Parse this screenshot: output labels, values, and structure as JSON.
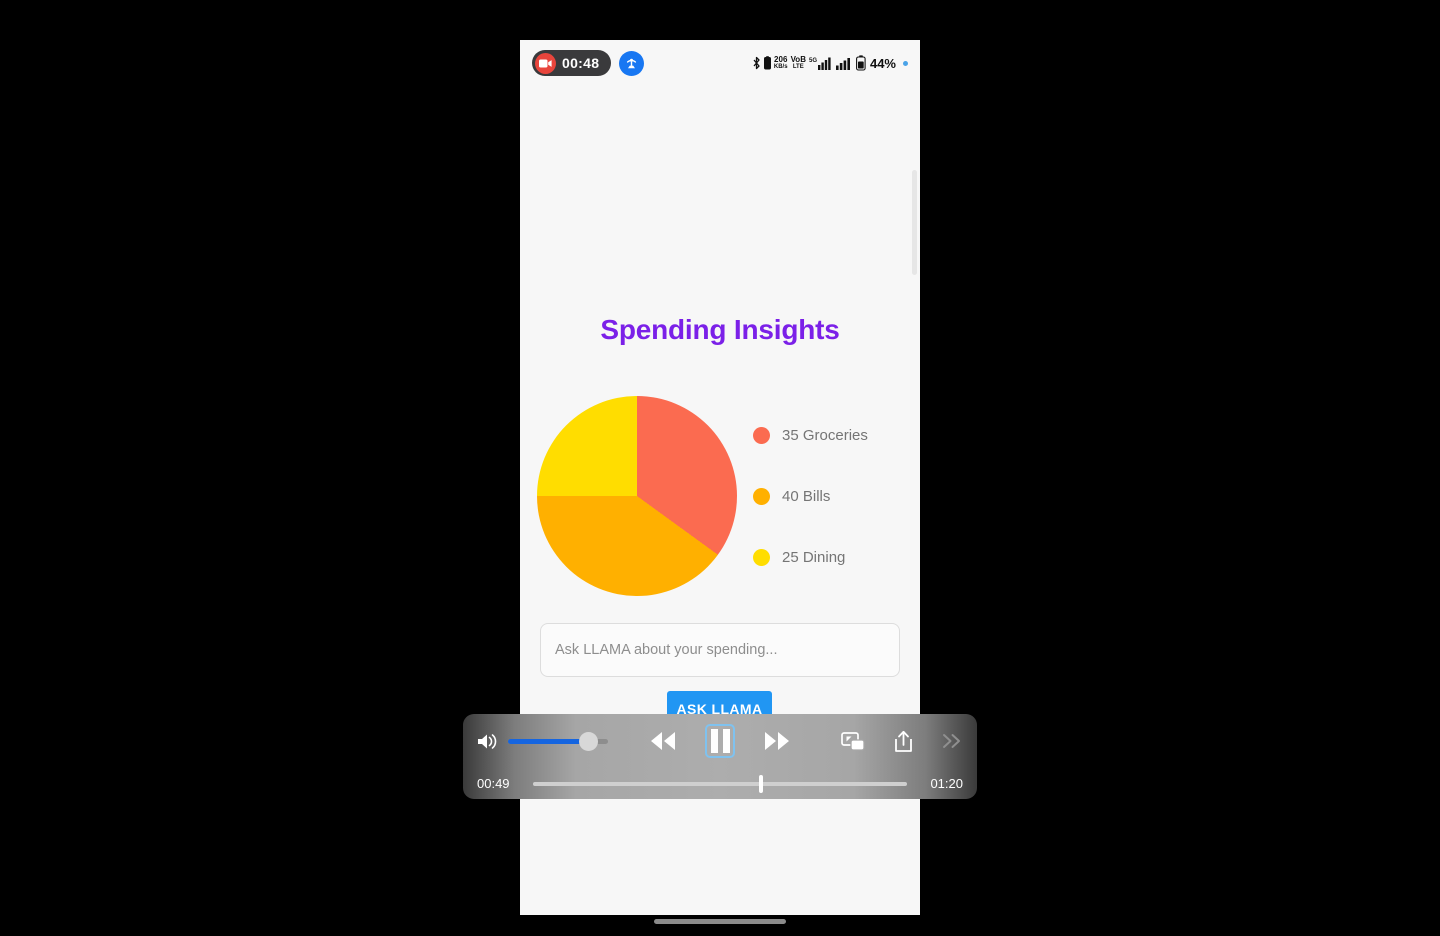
{
  "status_bar": {
    "recording_time": "00:48",
    "recording_icon": "camcorder-icon",
    "cast_icon": "screen-cast-icon",
    "bluetooth_icon": "bluetooth-icon",
    "data_speed_top": "206",
    "data_speed_bottom": "KB/s",
    "volte_top": "VoB",
    "volte_bottom": "LTE",
    "network_type": "5G",
    "battery_percent": "44%"
  },
  "page": {
    "title": "Spending Insights"
  },
  "chart_data": {
    "type": "pie",
    "title": "Spending Insights",
    "categories": [
      "Groceries",
      "Bills",
      "Dining"
    ],
    "values": [
      35,
      40,
      25
    ],
    "colors": [
      "#fb6b50",
      "#ffb000",
      "#ffdd00"
    ],
    "legend_position": "right",
    "legend": [
      {
        "label": "35 Groceries",
        "value": 35,
        "name": "Groceries",
        "color": "#fb6b50"
      },
      {
        "label": "40 Bills",
        "value": 40,
        "name": "Bills",
        "color": "#ffb000"
      },
      {
        "label": "25 Dining",
        "value": 25,
        "name": "Dining",
        "color": "#ffdd00"
      }
    ],
    "start_angle_deg": 0,
    "direction": "clockwise",
    "total": 100
  },
  "form": {
    "input_placeholder": "Ask LLAMA about your spending...",
    "input_value": "",
    "button_label": "ASK LLAMA",
    "button_color": "#2196f3"
  },
  "media_controls": {
    "volume_icon": "speaker-wave-icon",
    "volume_percent": 80,
    "rewind_icon": "rewind-icon",
    "pause_icon": "pause-icon",
    "forward_icon": "fast-forward-icon",
    "pip_icon": "picture-in-picture-icon",
    "share_icon": "share-icon",
    "expand_icon": "chevron-double-right-icon",
    "current_time": "00:49",
    "total_time": "01:20",
    "progress_percent": 61
  },
  "theme": {
    "title_purple": "#7b20e8",
    "accent_blue": "#2196f3",
    "page_background": "#f7f7f7",
    "outer_background": "#000000"
  }
}
